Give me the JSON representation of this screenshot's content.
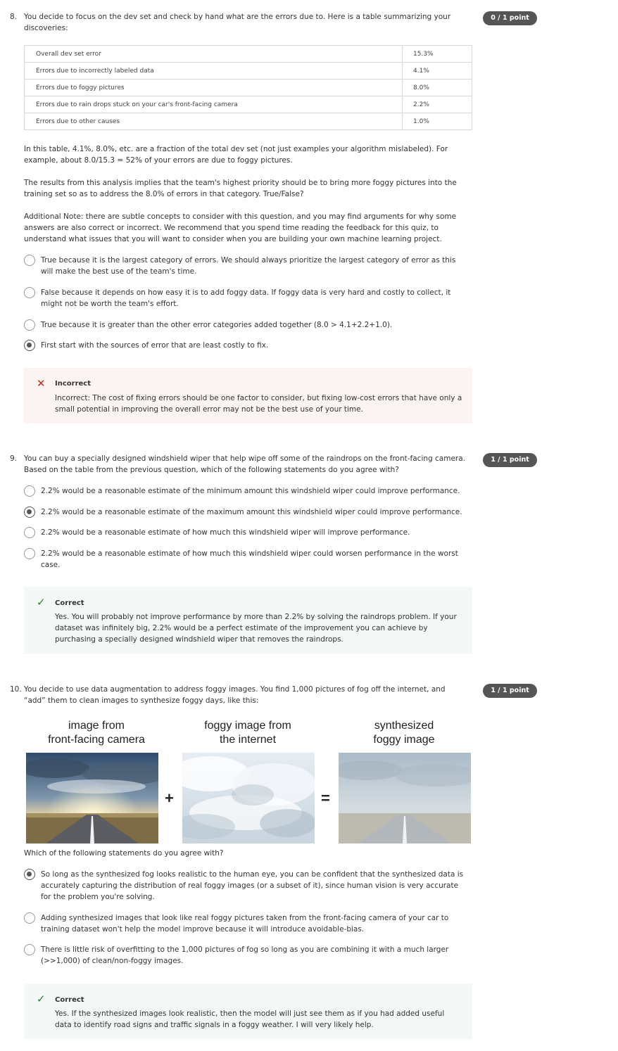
{
  "q8": {
    "number": "8.",
    "prompt": "You decide to focus on the dev set and check by hand what are the errors due to. Here is a table summarizing your discoveries:",
    "score": "0 / 1 point",
    "table": [
      [
        "Overall dev set error",
        "15.3%"
      ],
      [
        "Errors due to incorrectly labeled data",
        "4.1%"
      ],
      [
        "Errors due to foggy pictures",
        "8.0%"
      ],
      [
        "Errors due to rain drops stuck on your car's front-facing camera",
        "2.2%"
      ],
      [
        "Errors due to other causes",
        "1.0%"
      ]
    ],
    "note1": "In this table, 4.1%, 8.0%, etc. are a fraction of the total dev set (not just examples your algorithm mislabeled). For example, about 8.0/15.3 = 52% of your errors are due to foggy pictures.",
    "note2": "The results from this analysis implies that the team's highest priority should be to bring more foggy pictures into the training set so as to address the 8.0% of errors in that category. True/False?",
    "note3": "Additional Note: there are subtle concepts to consider with this question, and you may find arguments for why some answers are also correct or incorrect. We recommend that you spend time reading the feedback for this quiz, to understand what issues that you will want to consider when you are building your own machine learning project.",
    "options": [
      "True because it is the largest category of errors. We should always prioritize the largest category of error as this will make the best use of the team's time.",
      "False because it depends on how easy it is to add foggy data. If foggy data is very hard and costly to collect, it might not be worth the team's effort.",
      "True because it is greater than the other error categories added together (8.0 > 4.1+2.2+1.0).",
      "First start with the sources of error that are least costly to fix."
    ],
    "selected": 3,
    "feedback_title": "Incorrect",
    "feedback_body": "Incorrect: The cost of fixing errors should be one factor to consider, but fixing low-cost errors that have only a small potential in improving the overall error may not be the best use of your time."
  },
  "q9": {
    "number": "9.",
    "prompt": "You can buy a specially designed windshield wiper that help wipe off some of the raindrops on the front-facing camera. Based on the table from the previous question, which of the following statements do you agree with?",
    "score": "1 / 1 point",
    "options": [
      "2.2% would be a reasonable estimate of the minimum amount this windshield wiper could improve performance.",
      "2.2% would be a reasonable estimate of the maximum amount this windshield wiper could improve performance.",
      "2.2% would be a reasonable estimate of how much this windshield wiper will improve performance.",
      "2.2% would be a reasonable estimate of how much this windshield wiper could worsen performance in the worst case."
    ],
    "selected": 1,
    "feedback_title": "Correct",
    "feedback_body": "Yes. You will probably not improve performance by more than 2.2% by solving the raindrops problem. If your dataset was infinitely big, 2.2% would be a perfect estimate of the improvement you can achieve by purchasing a specially designed windshield wiper that removes the raindrops."
  },
  "q10": {
    "number": "10.",
    "prompt": "You decide to use data augmentation to address foggy images. You find 1,000 pictures of fog off the internet, and “add” them to clean images to synthesize foggy days, like this:",
    "score": "1 / 1 point",
    "captions": [
      "image from\nfront-facing camera",
      "foggy image from\nthe internet",
      "synthesized\nfoggy image"
    ],
    "plus": "+",
    "equals": "=",
    "question": "Which of the following statements do you agree with?",
    "options": [
      "So long as the synthesized fog looks realistic to the human eye, you can be confident that the synthesized data is accurately capturing the distribution of real foggy images (or a subset of it), since human vision is very accurate for the problem you're solving.",
      "Adding synthesized images that look like real foggy pictures taken from the front-facing camera of your car to training dataset won't help the model improve because it will introduce avoidable-bias.",
      "There is little risk of overfitting to the 1,000 pictures of fog so long as you are combining it with a much larger (>>1,000) of clean/non-foggy images."
    ],
    "selected": 0,
    "feedback_title": "Correct",
    "feedback_body": "Yes. If the synthesized images look realistic, then the model will just see them as if you had added useful data to identify road signs and traffic signals in a foggy weather. I will very likely help."
  },
  "icons": {
    "incorrect": "close-icon",
    "correct": "check-icon"
  },
  "colors": {
    "badge": "#555555",
    "incorrect_bg": "#fcf3f3",
    "correct_bg": "#f4f8f7",
    "incorrect_icon": "#c7281d",
    "correct_icon": "#2f7d32"
  }
}
